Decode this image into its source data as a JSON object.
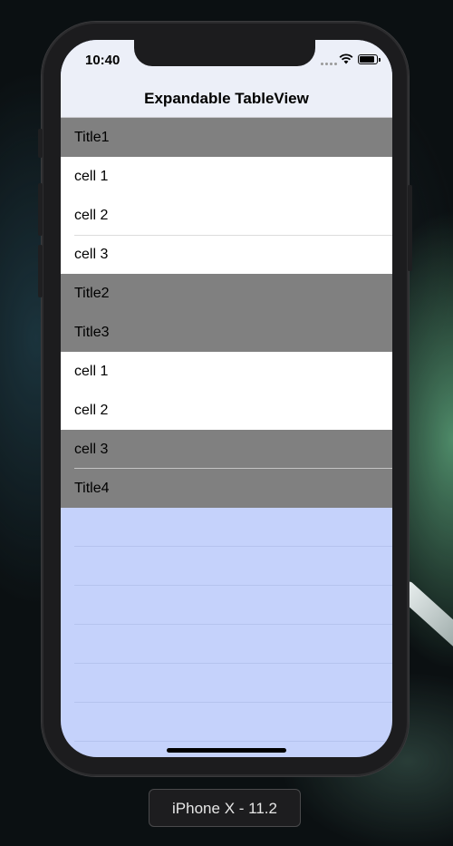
{
  "status_bar": {
    "time": "10:40",
    "icons": [
      "signal-dots-icon",
      "wifi-icon",
      "battery-icon"
    ]
  },
  "nav_bar": {
    "title": "Expandable TableView"
  },
  "table": {
    "rows": [
      {
        "label": "Title1",
        "kind": "section-header"
      },
      {
        "label": "cell 1",
        "kind": "cell"
      },
      {
        "label": "cell 2",
        "kind": "cell"
      },
      {
        "label": "cell 3",
        "kind": "cell"
      },
      {
        "label": "Title2",
        "kind": "section-header"
      },
      {
        "label": "Title3",
        "kind": "section-header"
      },
      {
        "label": "cell 1",
        "kind": "cell"
      },
      {
        "label": "cell 2",
        "kind": "cell"
      },
      {
        "label": "cell 3",
        "kind": "cell-highlighted"
      },
      {
        "label": "Title4",
        "kind": "section-header"
      }
    ]
  },
  "simulator": {
    "device_label": "iPhone X - 11.2"
  },
  "colors": {
    "section_header": "#808080",
    "cell": "#ffffff",
    "table_background": "#c5d2fb",
    "nav_background": "#eceff8"
  }
}
